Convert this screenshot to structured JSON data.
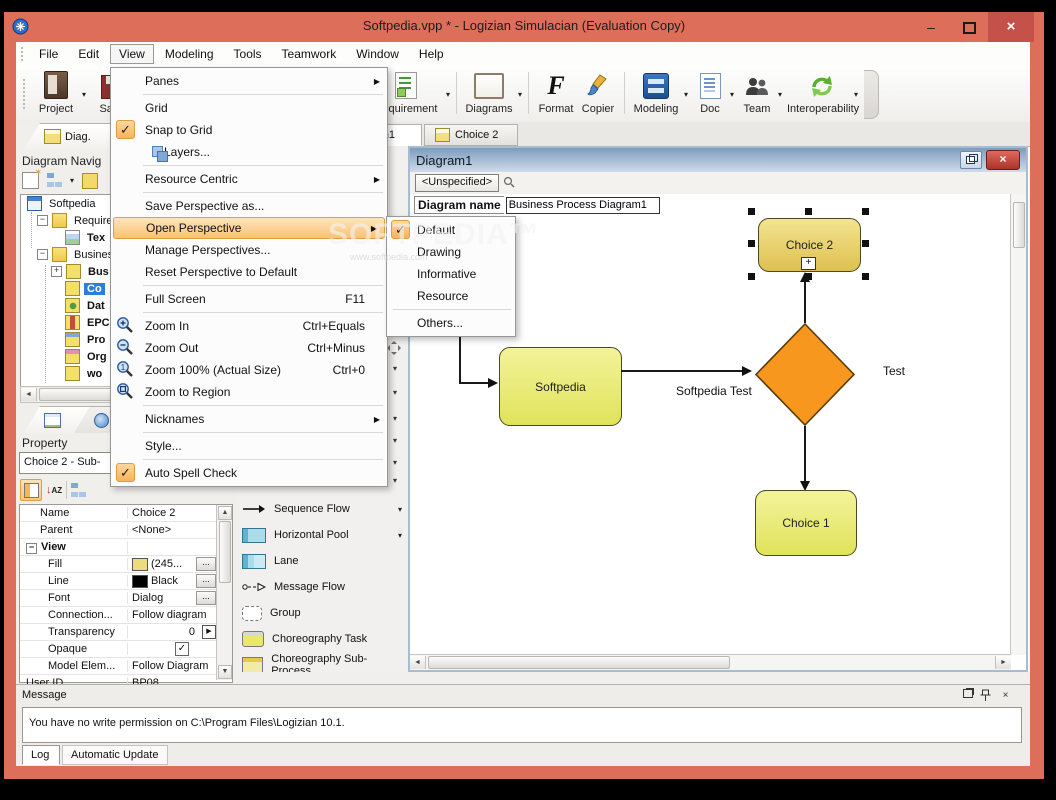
{
  "window": {
    "title": "Softpedia.vpp * - Logizian Simulacian (Evaluation Copy)",
    "controls": {
      "minimize": "–",
      "close": "×"
    }
  },
  "glyphs": {
    "check": "✓",
    "submenu_arrow": "▶",
    "caret": "▾",
    "scroll_down": "▼",
    "plus": "+",
    "minus": "−",
    "expand_plus": "+",
    "expand_minus": "−"
  },
  "menubar": {
    "items": [
      "File",
      "Edit",
      "View",
      "Modeling",
      "Tools",
      "Teamwork",
      "Window",
      "Help"
    ]
  },
  "toolbar": {
    "groups": [
      {
        "label": "Project",
        "icon": "project-icon"
      },
      {
        "label": "Save",
        "icon": "save-icon"
      },
      {
        "label": "Requirement",
        "icon": "requirement-icon"
      },
      {
        "label": "Diagrams",
        "icon": "diagrams-icon"
      },
      {
        "label": "Format",
        "icon": "format-icon"
      },
      {
        "label": "Copier",
        "icon": "copier-icon"
      },
      {
        "label": "Modeling",
        "icon": "modeling-icon"
      },
      {
        "label": "Doc",
        "icon": "doc-icon"
      },
      {
        "label": "Team",
        "icon": "team-icon"
      },
      {
        "label": "Interoperability",
        "icon": "interoperability-icon"
      }
    ]
  },
  "view_menu": {
    "items": [
      {
        "label": "Panes",
        "submenu": true
      },
      {
        "separator": true
      },
      {
        "label": "Grid"
      },
      {
        "label": "Snap to Grid",
        "checked": true
      },
      {
        "label": "Layers...",
        "icon": "layers-icon"
      },
      {
        "separator": true
      },
      {
        "label": "Resource Centric",
        "submenu": true
      },
      {
        "separator": true
      },
      {
        "label": "Save Perspective as..."
      },
      {
        "label": "Open Perspective",
        "submenu": true,
        "highlighted": true
      },
      {
        "label": "Manage Perspectives..."
      },
      {
        "label": "Reset Perspective to Default"
      },
      {
        "separator": true
      },
      {
        "label": "Full Screen",
        "shortcut": "F11"
      },
      {
        "separator": true
      },
      {
        "label": "Zoom In",
        "shortcut": "Ctrl+Equals",
        "icon": "zoom-in-icon"
      },
      {
        "label": "Zoom Out",
        "shortcut": "Ctrl+Minus",
        "icon": "zoom-out-icon"
      },
      {
        "label": "Zoom 100% (Actual Size)",
        "shortcut": "Ctrl+0",
        "icon": "zoom-100-icon"
      },
      {
        "label": "Zoom to Region",
        "icon": "zoom-region-icon"
      },
      {
        "separator": true
      },
      {
        "label": "Nicknames",
        "submenu": true
      },
      {
        "separator": true
      },
      {
        "label": "Style..."
      },
      {
        "separator": true
      },
      {
        "label": "Auto Spell Check",
        "checked": true
      }
    ]
  },
  "perspective_submenu": {
    "items": [
      {
        "label": "Default",
        "checked": true
      },
      {
        "label": "Drawing"
      },
      {
        "label": "Informative"
      },
      {
        "label": "Resource"
      },
      {
        "separator": true
      },
      {
        "label": "Others..."
      }
    ]
  },
  "navigator": {
    "tab": "Diag.",
    "title": "Diagram Navig",
    "tree": [
      {
        "label": "Softpedia",
        "icon": "project-icon"
      },
      {
        "label": "Require",
        "icon": "folder-icon",
        "expanded": true
      },
      {
        "label": "Tex",
        "icon": "textual-analysis-icon",
        "bold": true
      },
      {
        "label": "Busines",
        "icon": "folder-icon",
        "expanded": true
      },
      {
        "label": "Bus",
        "icon": "business-process-diagram-icon",
        "bold": true,
        "collapsed": true
      },
      {
        "label": "Co",
        "icon": "conversation-diagram-icon",
        "bold": true,
        "selected": true
      },
      {
        "label": "Dat",
        "icon": "data-flow-diagram-icon",
        "bold": true
      },
      {
        "label": "EPC",
        "icon": "epc-diagram-icon",
        "bold": true
      },
      {
        "label": "Pro",
        "icon": "process-map-icon",
        "bold": true
      },
      {
        "label": "Org",
        "icon": "org-chart-icon",
        "bold": true
      },
      {
        "label": "wo",
        "icon": "workflow-diagram-icon",
        "bold": true
      }
    ]
  },
  "property_panel": {
    "title": "Property",
    "selector": "Choice 2 - Sub-",
    "ellipsis": "...",
    "rows": [
      {
        "name": "Name",
        "value": "Choice 2"
      },
      {
        "name": "Parent",
        "value": "<None>"
      },
      {
        "name": "View",
        "value": "",
        "group": true
      },
      {
        "name": "Fill",
        "value": "(245...",
        "swatch": "#eddc7e",
        "button": true
      },
      {
        "name": "Line",
        "value": "Black",
        "swatch": "#000000",
        "button": true
      },
      {
        "name": "Font",
        "value": "Dialog",
        "button": true
      },
      {
        "name": "Connection...",
        "value": "Follow diagram"
      },
      {
        "name": "Transparency",
        "value": "0",
        "spinner": true
      },
      {
        "name": "Opaque",
        "value": "",
        "checkbox": true
      },
      {
        "name": "Model Elem...",
        "value": "Follow Diagram"
      },
      {
        "name": "User ID",
        "value": "BP08"
      }
    ]
  },
  "palette": {
    "items": [
      {
        "label": "Sequence Flow",
        "icon": "sequence-flow-icon",
        "caret": true
      },
      {
        "label": "Horizontal Pool",
        "icon": "horizontal-pool-icon",
        "caret": true
      },
      {
        "label": "Lane",
        "icon": "lane-icon"
      },
      {
        "label": "Message Flow",
        "icon": "message-flow-icon"
      },
      {
        "label": "Group",
        "icon": "group-icon"
      },
      {
        "label": "Choreography Task",
        "icon": "choreography-task-icon"
      },
      {
        "label": "Choreography Sub-Process",
        "icon": "choreography-sub-process-icon"
      }
    ]
  },
  "editor": {
    "tabs": [
      {
        "label": "Business Process Diagram1",
        "active": true
      },
      {
        "label": "Choice 2",
        "active": false
      }
    ],
    "diagram_window": {
      "title": "Diagram1",
      "dropdown": "<Unspecified>",
      "name_label": "Diagram name",
      "name_value": "Business Process Diagram1"
    },
    "shapes": {
      "choice2": "Choice 2",
      "softpedia": "Softpedia",
      "choice1": "Choice 1",
      "flow_label": "Softpedia Test",
      "gateway_label": "Test"
    }
  },
  "message_panel": {
    "title": "Message",
    "text": "You have no write permission on C:\\Program Files\\Logizian 10.1.",
    "tabs": [
      "Log",
      "Automatic Update"
    ]
  },
  "watermark": {
    "line1": "SOFTPEDIA™",
    "line2": "www.softpedia.com"
  },
  "colors": {
    "titlebar": "#dc6e5a",
    "close_button": "#c4524a",
    "selection_blue": "#2a7fde",
    "menu_highlight_orange": "#fbc173",
    "node_yellow_green": "#e9ee79",
    "node_gold": "#eedd76",
    "gateway_orange": "#f8971d",
    "diagram_titlebar_blue": "#9db9d4"
  }
}
